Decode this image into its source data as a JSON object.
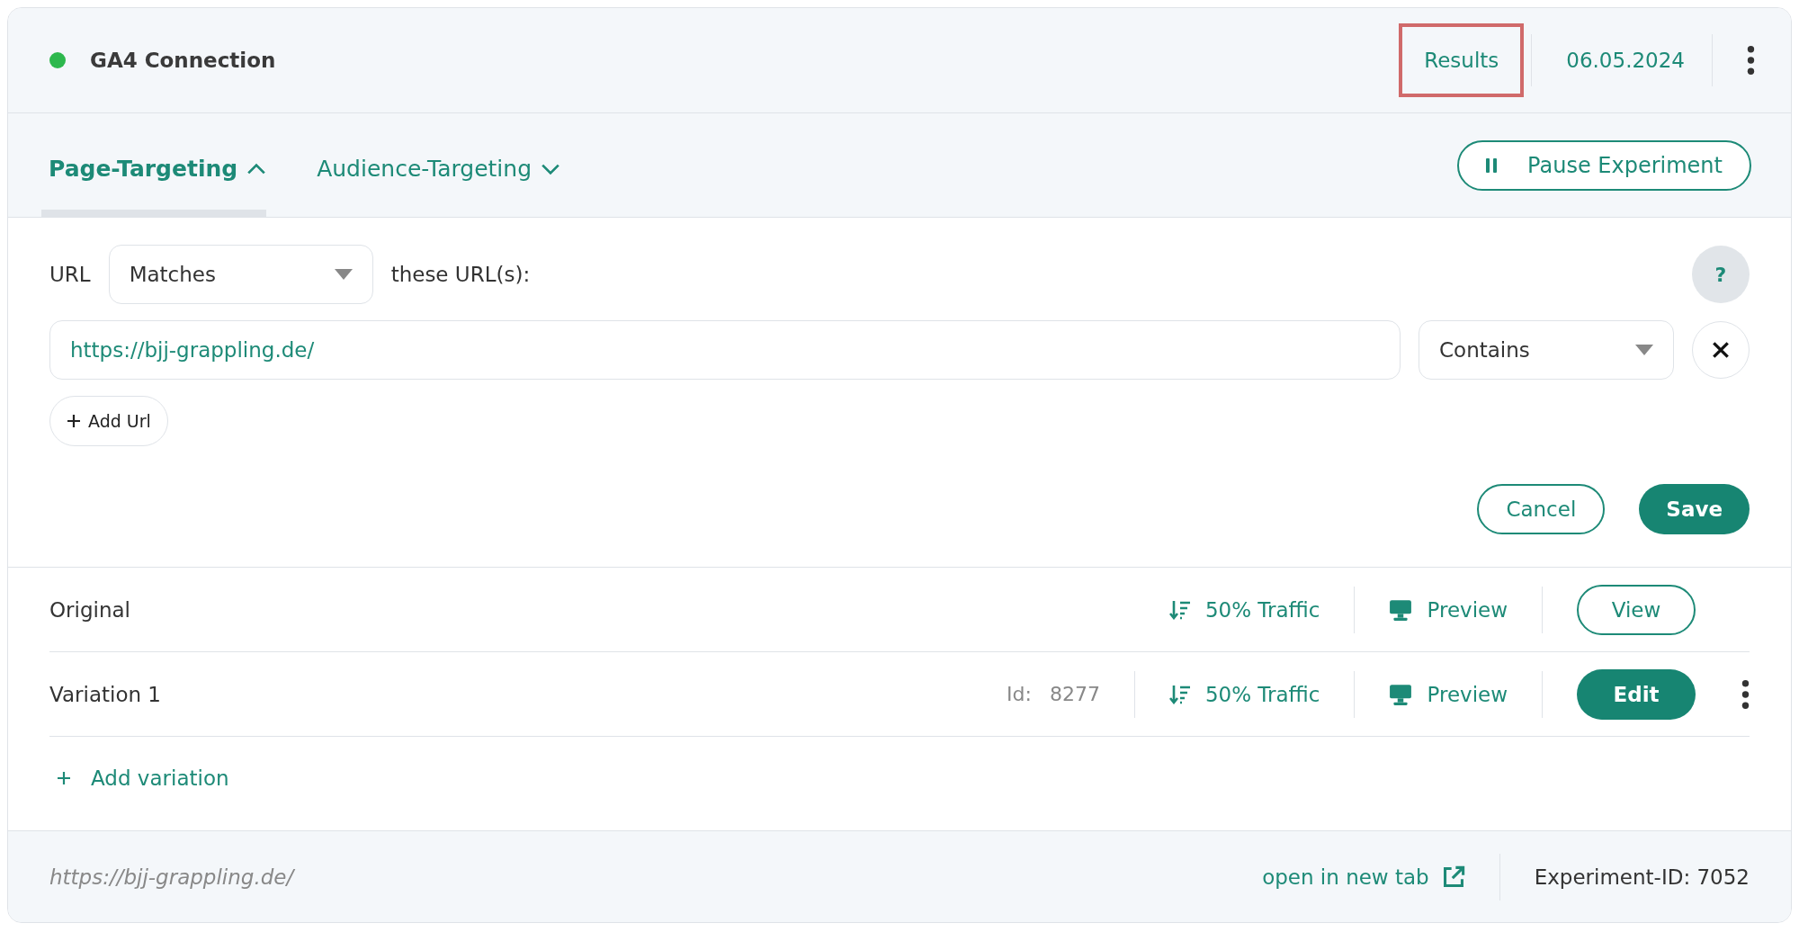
{
  "header": {
    "connected": true,
    "title": "GA4 Connection",
    "results": {
      "label": "Results",
      "highlighted": true
    },
    "date": "06.05.2024"
  },
  "tabs": [
    {
      "label": "Page-Targeting",
      "selected": true,
      "expanded": true
    },
    {
      "label": "Audience-Targeting",
      "selected": false,
      "expanded": false
    }
  ],
  "pause_button": "Pause Experiment",
  "url_rule": {
    "label": "URL",
    "match": "Matches",
    "suffix": "these URL(s):",
    "help": "?"
  },
  "urls": [
    {
      "value": "https://bjj-grappling.de/",
      "mode": "Contains"
    }
  ],
  "add_url": "Add Url",
  "cancel": "Cancel",
  "save": "Save",
  "variations": [
    {
      "name": "Original",
      "traffic": "50% Traffic",
      "preview": "Preview",
      "action": {
        "kind": "outline",
        "label": "View"
      },
      "menu": false
    },
    {
      "name": "Variation 1",
      "id_label": "Id:",
      "id_value": "8277",
      "traffic": "50% Traffic",
      "preview": "Preview",
      "action": {
        "kind": "filled",
        "label": "Edit"
      },
      "menu": true
    }
  ],
  "add_variation": "Add variation",
  "footer": {
    "url": "https://bjj-grappling.de/",
    "open_link": "open in new tab",
    "experiment_id": "Experiment-ID: 7052"
  }
}
